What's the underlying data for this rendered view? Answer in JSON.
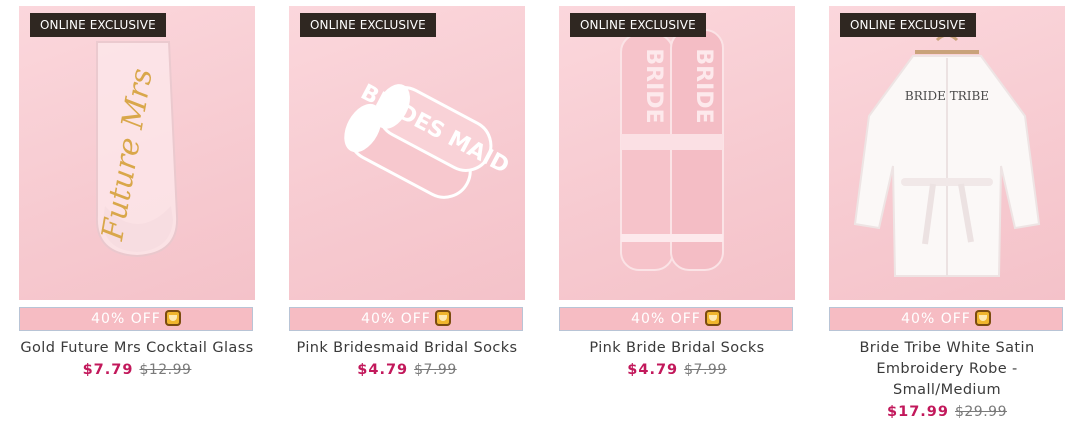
{
  "products": [
    {
      "badge": "ONLINE EXCLUSIVE",
      "discount": "40% OFF",
      "name": "Gold Future Mrs Cocktail Glass",
      "sale_price": "$7.79",
      "original_price": "$12.99",
      "image": "cocktail-glass",
      "image_text": "Future Mrs"
    },
    {
      "badge": "ONLINE EXCLUSIVE",
      "discount": "40% OFF",
      "name": "Pink Bridesmaid Bridal Socks",
      "sale_price": "$4.79",
      "original_price": "$7.99",
      "image": "bridesmaid-socks",
      "image_text": "BRIDES MAID"
    },
    {
      "badge": "ONLINE EXCLUSIVE",
      "discount": "40% OFF",
      "name": "Pink Bride Bridal Socks",
      "sale_price": "$4.79",
      "original_price": "$7.99",
      "image": "bride-socks",
      "image_text": "BRIDE"
    },
    {
      "badge": "ONLINE EXCLUSIVE",
      "discount": "40% OFF",
      "name": "Bride Tribe White Satin Embroidery Robe - Small/Medium",
      "sale_price": "$17.99",
      "original_price": "$29.99",
      "image": "satin-robe",
      "image_text": "BRIDE TRIBE"
    }
  ],
  "colors": {
    "badge_bg": "#2f2721",
    "discount_bg": "#f6bcc3",
    "sale_price": "#c2185b"
  }
}
